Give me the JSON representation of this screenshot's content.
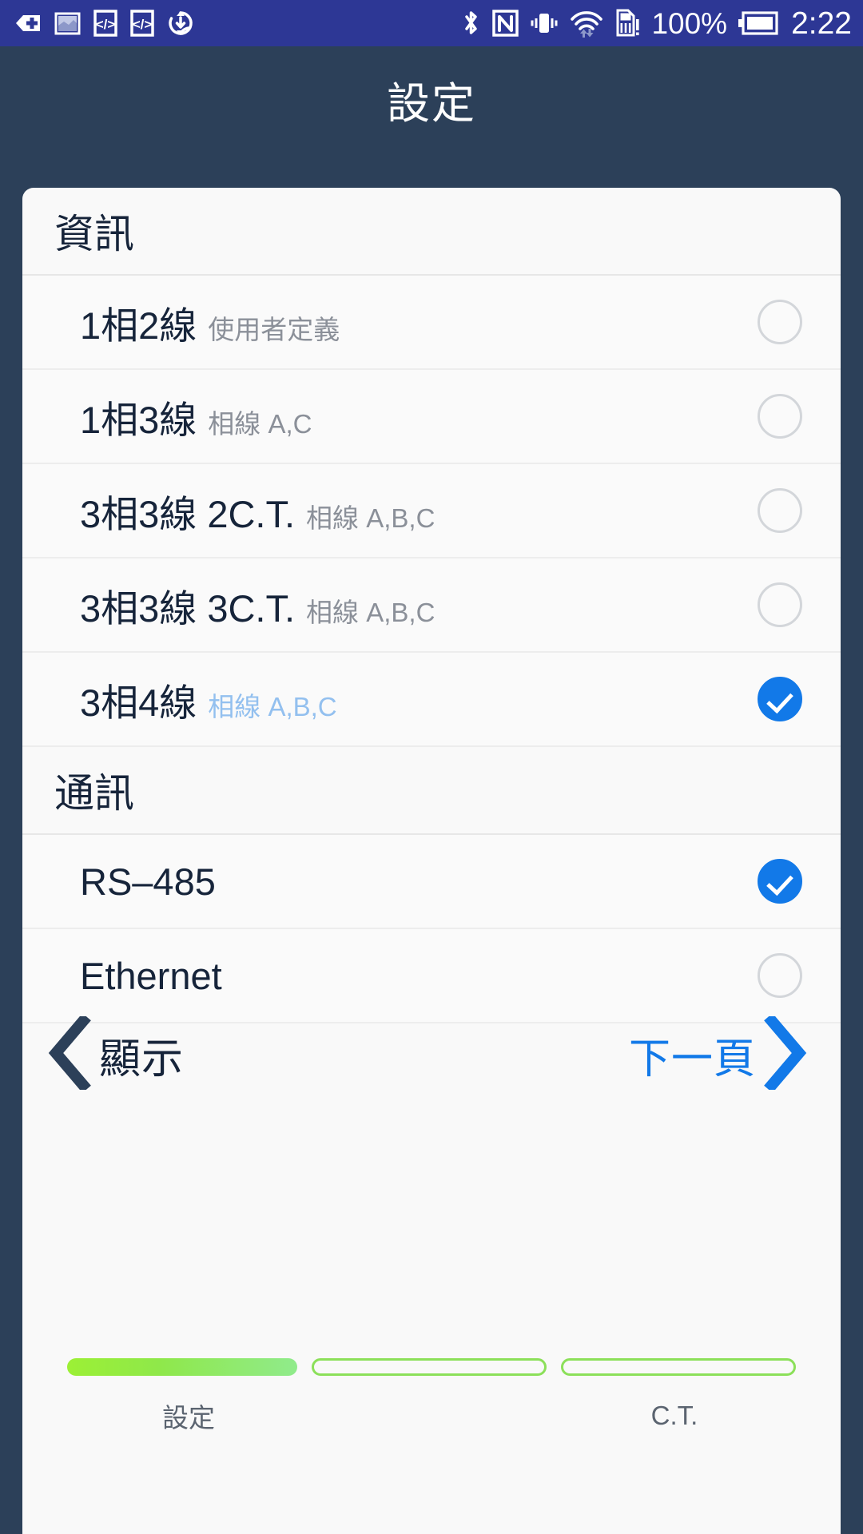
{
  "statusbar": {
    "icons_left": [
      "back-plus-icon",
      "screenshot-image-icon",
      "code-brackets-icon",
      "code-brackets-icon-2",
      "sync-download-icon"
    ],
    "icons_right": [
      "bluetooth-icon",
      "nfc-icon",
      "vibrate-icon",
      "wifi-transfer-icon",
      "sim-card-alert-icon"
    ],
    "battery_percent": "100%",
    "battery_icon": "battery-full-icon",
    "time": "2:22"
  },
  "header": {
    "title": "設定"
  },
  "sections": [
    {
      "id": "info",
      "title": "資訊",
      "rows": [
        {
          "title": "1相2線",
          "subtitle": "使用者定義",
          "selected": false
        },
        {
          "title": "1相3線",
          "subtitle": "相線 A,C",
          "selected": false
        },
        {
          "title": "3相3線 2C.T.",
          "subtitle": "相線 A,B,C",
          "selected": false
        },
        {
          "title": "3相3線 3C.T.",
          "subtitle": "相線 A,B,C",
          "selected": false
        },
        {
          "title": "3相4線",
          "subtitle": "相線 A,B,C",
          "selected": true
        }
      ]
    },
    {
      "id": "comm",
      "title": "通訊",
      "rows": [
        {
          "title": "RS–485",
          "subtitle": "",
          "selected": true
        },
        {
          "title": "Ethernet",
          "subtitle": "",
          "selected": false
        }
      ]
    }
  ],
  "nav": {
    "prev_label": "顯示",
    "prev_icon": "chevron-left-icon",
    "next_label": "下一頁",
    "next_icon": "chevron-right-icon"
  },
  "stepper": {
    "steps": [
      {
        "label": "設定",
        "state": "done"
      },
      {
        "label": "",
        "state": "pending"
      },
      {
        "label": "C.T.",
        "state": "pending"
      }
    ]
  },
  "colors": {
    "statusbar_bg": "#2d3795",
    "header_bg": "#2c4059",
    "card_bg": "#f9f9f9",
    "accent_blue": "#1279e8",
    "selected_sub": "#93c0ef",
    "step_green": "#8ce05a",
    "text_dark": "#16243a",
    "text_muted": "#8b9099"
  }
}
